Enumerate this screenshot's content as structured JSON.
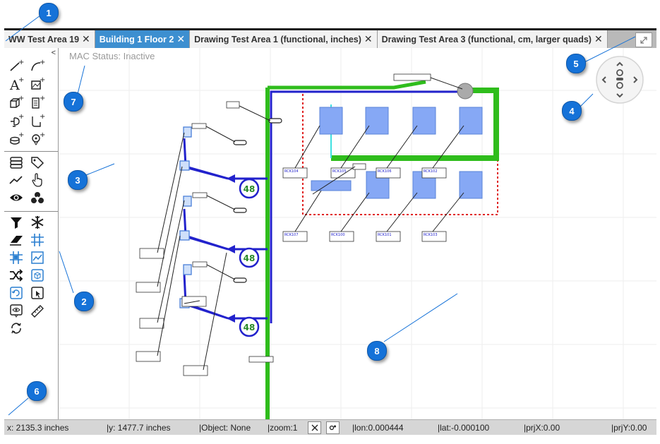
{
  "tabs": [
    {
      "label": "WW Test Area 19",
      "active": false
    },
    {
      "label": "Building 1 Floor 2",
      "active": true
    },
    {
      "label": "Drawing Test Area 1 (functional, inches)",
      "active": false
    },
    {
      "label": "Drawing Test Area 3 (functional, cm, larger quads)",
      "active": false
    }
  ],
  "tab_close_glyph": "✕",
  "expand_icon": "expand-icon",
  "toolbar": {
    "collapse_glyph": "<"
  },
  "canvas": {
    "mac_status": "MAC Status: Inactive"
  },
  "status": {
    "x": "x: 2135.3 inches",
    "y": "|y: 1477.7 inches",
    "object": "|Object: None",
    "zoom": "|zoom:1",
    "lon": "|lon:0.000444",
    "lat": "|lat:-0.000100",
    "prjx": "|prjX:0.00",
    "prjy": "|prjY:0.00"
  },
  "rack_labels": [
    "RCK104",
    "RCK105",
    "RCK106",
    "RCK102",
    "RCK107",
    "RCK100",
    "RCK101",
    "RCK103"
  ],
  "port_count": "48",
  "callouts": [
    "1",
    "2",
    "3",
    "4",
    "5",
    "6",
    "7",
    "8"
  ],
  "colors": {
    "active_tab": "#3d8fd0",
    "callout": "#1572d8",
    "conduit_green": "#2fbd1c",
    "cable_blue": "#2222cc",
    "rack_blue": "#86a8f5",
    "boundary_red": "#e02020"
  }
}
